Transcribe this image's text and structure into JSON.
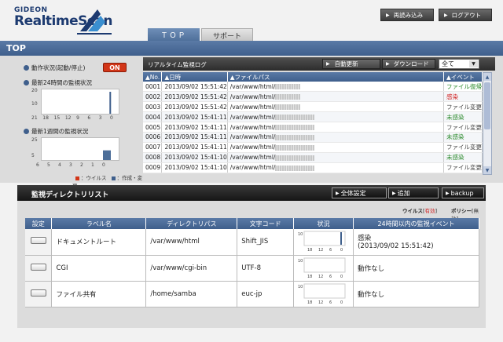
{
  "header": {
    "brand_top": "GIDEON",
    "brand_main": "RealtimeScan",
    "reload_label": "再読み込み",
    "logout_label": "ログアウト"
  },
  "tabs": [
    {
      "label": "ＴＯＰ",
      "active": true
    },
    {
      "label": "サポート",
      "active": false
    }
  ],
  "page_title": "TOP",
  "status": {
    "toggle_label": "動作状況(起動/停止)",
    "on_label": "ON",
    "last24_label": "最新24時間の監視状況",
    "last24_ticks_x": [
      "21",
      "18",
      "15",
      "12",
      "9",
      "6",
      "3",
      "0"
    ],
    "last24_ticks_y": [
      "20",
      "10"
    ],
    "last24_bar_at": 3,
    "lastweek_label": "最新1週間の監視状況",
    "lastweek_ticks_x": [
      "6",
      "5",
      "4",
      "3",
      "2",
      "1",
      "0"
    ],
    "lastweek_ticks_y": [
      "25",
      "5"
    ],
    "lastweek_bar_value": 5,
    "legend_virus": "：ウイルス",
    "legend_change": "：作成・変更",
    "colors": {
      "virus": "#d23618",
      "change": "#3f5f8c"
    }
  },
  "log": {
    "title": "リアルタイム監視ログ",
    "auto_refresh": "自動更新",
    "download": "ダウンロード",
    "filter_value": "全て",
    "columns": [
      "▲No.",
      "▲日時",
      "▲ファイルパス",
      "▲イベント"
    ],
    "rows": [
      {
        "no": "0001",
        "time": "2013/09/02 15:51:42",
        "path": "/var/www/html/",
        "event": "ファイル復帰",
        "cls": "ev-green",
        "blur": "short"
      },
      {
        "no": "0002",
        "time": "2013/09/02 15:51:42",
        "path": "/var/www/html/",
        "event": "感染",
        "cls": "ev-red",
        "blur": "short"
      },
      {
        "no": "0003",
        "time": "2013/09/02 15:51:42",
        "path": "/var/www/html/",
        "event": "ファイル変更",
        "cls": "ev-gray",
        "blur": "short"
      },
      {
        "no": "0004",
        "time": "2013/09/02 15:41:11",
        "path": "/var/www/html/",
        "event": "未感染",
        "cls": "ev-green",
        "blur": "wide"
      },
      {
        "no": "0005",
        "time": "2013/09/02 15:41:11",
        "path": "/var/www/html/",
        "event": "ファイル変更",
        "cls": "ev-gray",
        "blur": "wide"
      },
      {
        "no": "0006",
        "time": "2013/09/02 15:41:11",
        "path": "/var/www/html/",
        "event": "未感染",
        "cls": "ev-green",
        "blur": "wide"
      },
      {
        "no": "0007",
        "time": "2013/09/02 15:41:11",
        "path": "/var/www/html/",
        "event": "ファイル変更",
        "cls": "ev-gray",
        "blur": "wide"
      },
      {
        "no": "0008",
        "time": "2013/09/02 15:41:10",
        "path": "/var/www/html/",
        "event": "未感染",
        "cls": "ev-green",
        "blur": "wide"
      },
      {
        "no": "0009",
        "time": "2013/09/02 15:41:10",
        "path": "/var/www/html/",
        "event": "ファイル変更",
        "cls": "ev-gray",
        "blur": "wide"
      }
    ]
  },
  "dirlist": {
    "title": "監視ディレクトリリスト",
    "global_settings": "全体設定",
    "add": "追加",
    "backup": "backup",
    "virus_label": "ウイルス",
    "virus_value": "有効",
    "policy_label": "ポリシー",
    "policy_value": "無効",
    "columns": [
      "設定",
      "ラベル名",
      "ディレクトリパス",
      "文字コード",
      "状況",
      "24時間以内の監視イベント"
    ],
    "spark_ticks": [
      "18",
      "12",
      "6",
      "0"
    ],
    "spark_y": "10",
    "rows": [
      {
        "label": "ドキュメントルート",
        "path": "/var/www/html",
        "encoding": "Shift_JIS",
        "event": "感染",
        "event2": "(2013/09/02 15:51:42)",
        "has_bar": true
      },
      {
        "label": "CGI",
        "path": "/var/www/cgi-bin",
        "encoding": "UTF-8",
        "event": "動作なし",
        "event2": "",
        "has_bar": false
      },
      {
        "label": "ファイル共有",
        "path": "/home/samba",
        "encoding": "euc-jp",
        "event": "動作なし",
        "event2": "",
        "has_bar": false
      }
    ]
  }
}
